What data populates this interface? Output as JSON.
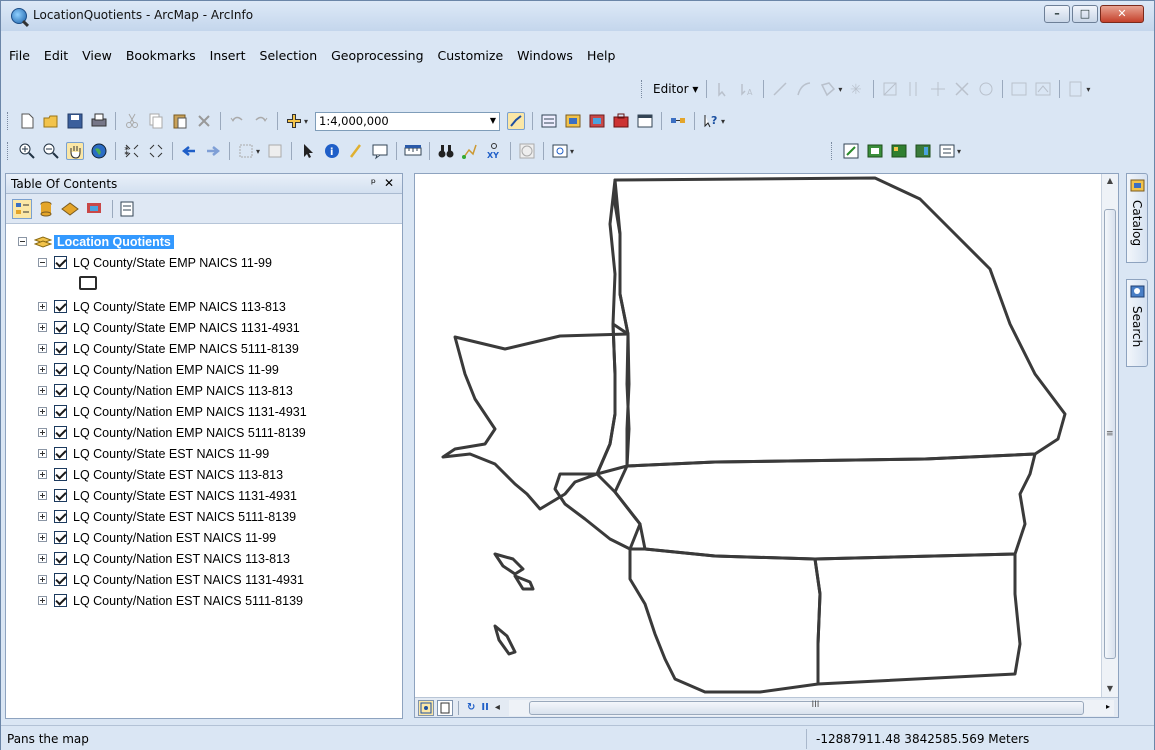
{
  "window": {
    "title": "LocationQuotients - ArcMap - ArcInfo",
    "minimize_glyph": "–",
    "maximize_glyph": "□",
    "close_glyph": "✕"
  },
  "menu": [
    "File",
    "Edit",
    "View",
    "Bookmarks",
    "Insert",
    "Selection",
    "Geoprocessing",
    "Customize",
    "Windows",
    "Help"
  ],
  "editor_toolbar": {
    "label": "Editor ▾"
  },
  "standard_toolbar": {
    "scale": "1:4,000,000"
  },
  "toc": {
    "title": "Table Of Contents",
    "pin_glyph": "ᵖ",
    "close_glyph": "✕",
    "data_frame": "Location Quotients",
    "layers": [
      "LQ County/State EMP  NAICS 11-99",
      "LQ County/State EMP NAICS 113-813",
      "LQ County/State EMP NAICS 1131-4931",
      "LQ County/State EMP NAICS 5111-8139",
      "LQ County/Nation EMP NAICS 11-99",
      "LQ County/Nation EMP  NAICS 113-813",
      "LQ County/Nation EMP NAICS 1131-4931",
      "LQ County/Nation EMP NAICS 5111-8139",
      "LQ County/State EST NAICS 11-99",
      "LQ County/State EST NAICS 113-813",
      "LQ County/State EST NAICS 1131-4931",
      "LQ County/State EST NAICS 5111-8139",
      "LQ County/Nation EST NAICS 11-99",
      "LQ County/Nation EST NAICS 113-813",
      "LQ County/Nation EST NAICS 1131-4931",
      "LQ County/Nation EST NAICS 5111-8139"
    ]
  },
  "side_tabs": {
    "catalog": "Catalog",
    "search": "Search"
  },
  "map_bottom": {
    "refresh_glyph": "↻",
    "pause_glyph": "II",
    "left_arrow": "◂",
    "right_arrow": "▸",
    "grip": "III"
  },
  "status": {
    "message": "Pans the map",
    "coordinates": "-12887911.48  3842585.569 Meters"
  },
  "colors": {
    "map_outline": "#3a3a3a",
    "selection": "#3399ff"
  }
}
